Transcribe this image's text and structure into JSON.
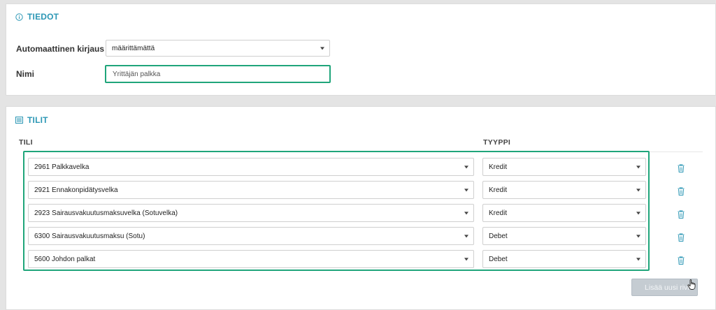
{
  "tiedot": {
    "title": "TIEDOT",
    "auto_label": "Automaattinen kirjaus",
    "auto_value": "määrittämättä",
    "name_label": "Nimi",
    "name_value": "Yrittäjän palkka"
  },
  "tilit": {
    "title": "TILIT",
    "col_account": "TILI",
    "col_type": "TYYPPI",
    "rows": [
      {
        "account": "2961 Palkkavelka",
        "type": "Kredit"
      },
      {
        "account": "2921 Ennakonpidätysvelka",
        "type": "Kredit"
      },
      {
        "account": "2923 Sairausvakuutusmaksuvelka (Sotuvelka)",
        "type": "Kredit"
      },
      {
        "account": "6300 Sairausvakuutusmaksu (Sotu)",
        "type": "Debet"
      },
      {
        "account": "5600 Johdon palkat",
        "type": "Debet"
      }
    ],
    "add_button": "Lisää uusi rivi"
  },
  "colors": {
    "accent": "#2c97b5",
    "highlight": "#1fa57a",
    "button": "#c5ccd2"
  }
}
